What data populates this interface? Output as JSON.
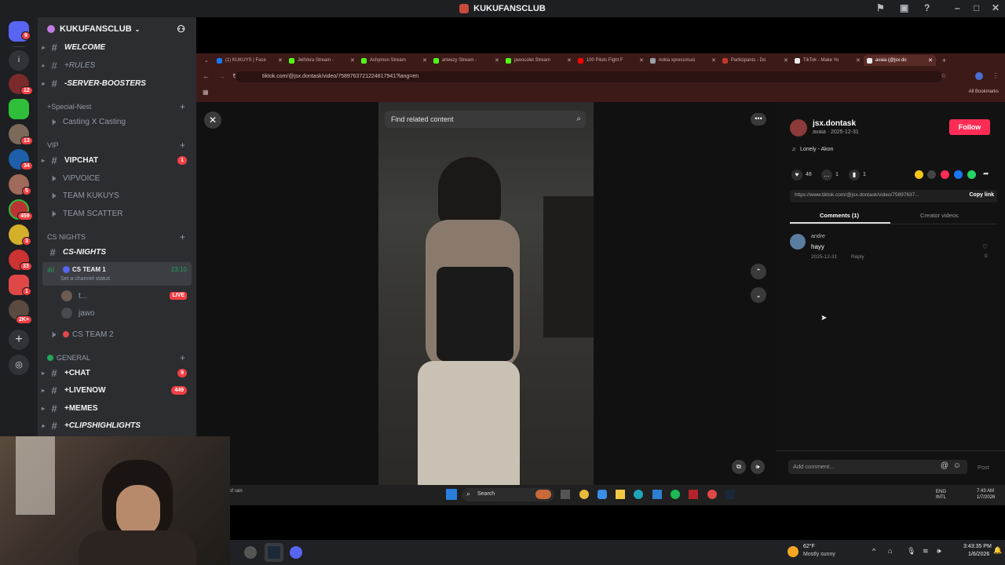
{
  "discord": {
    "window_title": "KUKUFANSCLUB",
    "server_name": "KUKUFANSCLUB",
    "rail_badges": [
      "9",
      "12",
      "13",
      "34",
      "5",
      "459",
      "3",
      "33",
      "1",
      "2K+"
    ],
    "categories": {
      "special_nest": "+Special-Nest",
      "vip": "VIP",
      "cs_nights": "CS NIGHTS",
      "general": "GENERAL"
    },
    "channels": {
      "welcome": "WELCOME",
      "rules": "+RULES",
      "server_boosters": "-SERVER-BOOSTERS",
      "casting": "Casting X Casting",
      "vipchat": "VIPCHAT",
      "vipchat_badge": "1",
      "vipvoice": "VIPVOICE",
      "team_kukuys": "TEAM KUKUYS",
      "team_scatter": "TEAM SCATTER",
      "cs_nights": "CS-NIGHTS",
      "cs_team1": "CS TEAM 1",
      "cs_team1_time": "23:10",
      "cs_team1_status": "Set a channel status",
      "voice_user1": "t...",
      "voice_user1_badge": "LIVE",
      "voice_user2": "jawo",
      "cs_team2": "CS TEAM 2",
      "chat": "+CHAT",
      "chat_badge": "9",
      "livenow": "+LIVENOW",
      "livenow_badge": "449",
      "memes": "+MEMES",
      "cliphighlights": "+CLIPSHIGHLIGHTS"
    }
  },
  "browser": {
    "tabs": [
      {
        "label": "(1) KUKUYS | Face",
        "color": "#1877f2"
      },
      {
        "label": "JeliVera Stream -",
        "color": "#53fc18"
      },
      {
        "label": "Achymon Stream",
        "color": "#53fc18"
      },
      {
        "label": "arteezy Stream -",
        "color": "#53fc18"
      },
      {
        "label": "jawocolet Stream",
        "color": "#53fc18"
      },
      {
        "label": "100 Pilots Fight F",
        "color": "#ff0000"
      },
      {
        "label": "nokia xpressmusi",
        "color": "#9aa0a6"
      },
      {
        "label": "Participants - Do",
        "color": "#c0392b"
      },
      {
        "label": "TikTok - Make Yo",
        "color": "#e9e9e9"
      },
      {
        "label": "avaia (@jsx.do",
        "color": "#e9e9e9"
      }
    ],
    "url": "tiktok.com/@jsx.dontask/video/7589763721224817941?lang=en",
    "bookmarks_label": "All Bookmarks"
  },
  "tiktok": {
    "search_placeholder": "Find related content",
    "username": "jsx.dontask",
    "display_meta": "avaia · 2025-12-31",
    "follow_label": "Follow",
    "sound": "Lonely - Akon",
    "likes": "48",
    "comments_count": "1",
    "saves": "1",
    "share_url": "https://www.tiktok.com/@jsx.dontask/video/75897637...",
    "copy_link_label": "Copy link",
    "tab_comments": "Comments (1)",
    "tab_creator": "Creator videos",
    "comment": {
      "author": "andre",
      "text": "hayy",
      "date": "2025-12-31",
      "reply_label": "Reply",
      "likes": "0"
    },
    "add_comment_placeholder": "Add comment...",
    "post_label": "Post"
  },
  "inner_taskbar": {
    "weather_text": "of rain",
    "search_label": "Search",
    "lang": "ENG INTL",
    "time": "7:43 AM",
    "date": "1/7/2026"
  },
  "host_taskbar": {
    "temp": "62°F",
    "weather": "Mostly sunny",
    "time": "3:43:35 PM",
    "date": "1/6/2026"
  }
}
